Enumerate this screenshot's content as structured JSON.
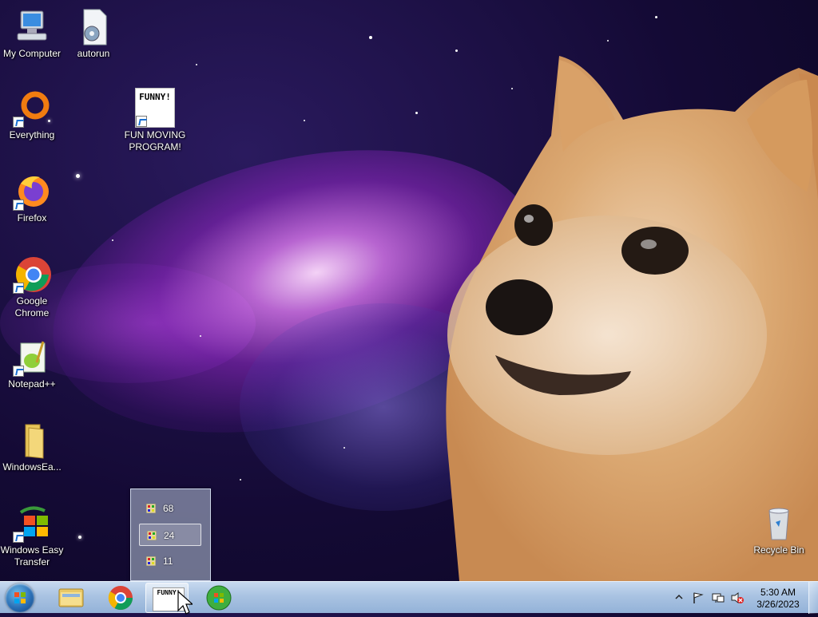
{
  "desktop": {
    "icons": [
      {
        "label": "My Computer"
      },
      {
        "label": "autorun"
      },
      {
        "label": "Everything"
      },
      {
        "label": "FUN MOVING PROGRAM!"
      },
      {
        "label": "Firefox"
      },
      {
        "label": "Google Chrome"
      },
      {
        "label": "Notepad++"
      },
      {
        "label": "WindowsEa..."
      },
      {
        "label": "Windows Easy Transfer"
      },
      {
        "label": "Recycle Bin"
      }
    ],
    "fun_thumb_text": "FUNNY!"
  },
  "jumplist": {
    "items": [
      {
        "label": "68"
      },
      {
        "label": "24"
      },
      {
        "label": "11"
      }
    ]
  },
  "taskbar": {
    "buttons": [
      "start-orb",
      "windows-explorer",
      "google-chrome",
      "fun-moving-program",
      "windows-media-center"
    ],
    "active_thumb_text": "FUNNY!",
    "clock_time": "5:30 AM",
    "clock_date": "3/26/2023"
  },
  "colors": {
    "taskbar": "#a9c3e2",
    "wallpaper_space": "#140a35",
    "nebula": "#c878e6"
  }
}
